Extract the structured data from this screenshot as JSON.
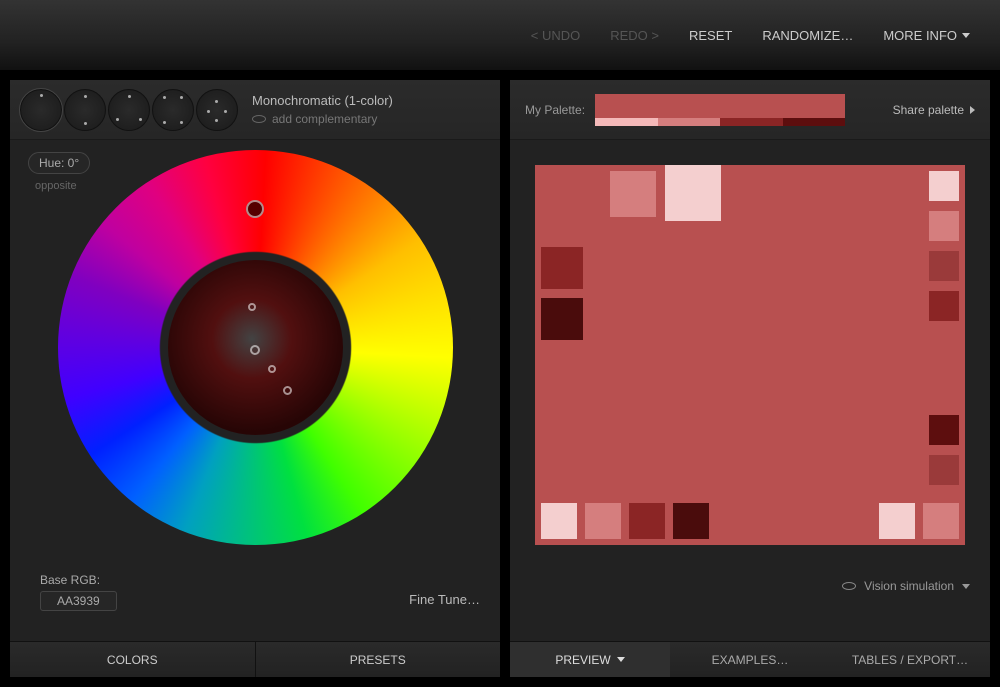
{
  "top": {
    "undo": "< UNDO",
    "redo": "REDO >",
    "reset": "RESET",
    "randomize": "RANDOMIZE…",
    "moreinfo": "MORE INFO"
  },
  "mode": {
    "title": "Monochromatic (1-color)",
    "subtitle": "add complementary"
  },
  "hue": {
    "label": "Hue: 0°",
    "opposite": "opposite"
  },
  "base": {
    "label": "Base RGB:",
    "value": "AA3939"
  },
  "finetune": "Fine Tune…",
  "leftTabs": {
    "colors": "COLORS",
    "presets": "PRESETS"
  },
  "rightTop": {
    "label": "My Palette:",
    "share": "Share palette"
  },
  "palette": {
    "main": [
      "#b85050",
      "#b85050",
      "#b85050",
      "#b85050"
    ],
    "sub": [
      "#f4b9b9",
      "#d57e7e",
      "#8b2525",
      "#5d0e0e"
    ]
  },
  "previewColors": {
    "bg": "#b85050",
    "lightPink": "#f4b9b9",
    "midPink": "#d57e7e",
    "darkRed": "#8b2525",
    "veryDark": "#5d0e0e"
  },
  "vision": "Vision simulation",
  "rightTabs": {
    "preview": "PREVIEW",
    "examples": "EXAMPLES…",
    "tables": "TABLES / EXPORT…"
  }
}
